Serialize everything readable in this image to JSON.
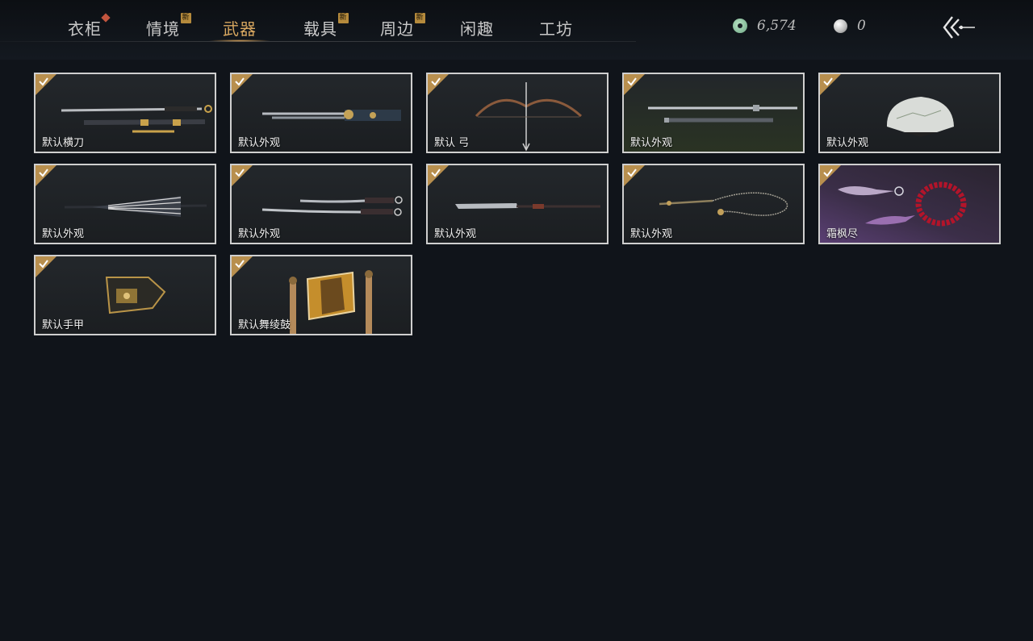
{
  "nav": {
    "tabs": [
      {
        "label": "衣柜",
        "badge": "dot"
      },
      {
        "label": "情境",
        "badge": "新"
      },
      {
        "label": "武器",
        "badge": ""
      },
      {
        "label": "载具",
        "badge": "新"
      },
      {
        "label": "周边",
        "badge": "新"
      },
      {
        "label": "闲趣",
        "badge": ""
      },
      {
        "label": "工坊",
        "badge": ""
      }
    ],
    "active_tab": "武器"
  },
  "currency": {
    "jade": {
      "icon": "jade-coin-icon",
      "value": "6,574"
    },
    "pearl": {
      "icon": "pearl-icon",
      "value": "0"
    }
  },
  "back": {
    "icon": "back-arrow-icon"
  },
  "items": [
    {
      "label": "默认横刀",
      "equipped": true
    },
    {
      "label": "默认外观",
      "equipped": true
    },
    {
      "label": "默认 弓",
      "equipped": true
    },
    {
      "label": "默认外观",
      "equipped": true
    },
    {
      "label": "默认外观",
      "equipped": true
    },
    {
      "label": "默认外观",
      "equipped": true
    },
    {
      "label": "默认外观",
      "equipped": true
    },
    {
      "label": "默认外观",
      "equipped": true
    },
    {
      "label": "默认外观",
      "equipped": true
    },
    {
      "label": "霜枫尽",
      "equipped": true
    },
    {
      "label": "默认手甲",
      "equipped": true
    },
    {
      "label": "默认舞绫鼓",
      "equipped": true
    }
  ],
  "colors": {
    "accent": "#d8a760",
    "equipped_corner": "#b88f4e",
    "badge_new": "#b58a3c",
    "badge_dot": "#c2553e"
  }
}
